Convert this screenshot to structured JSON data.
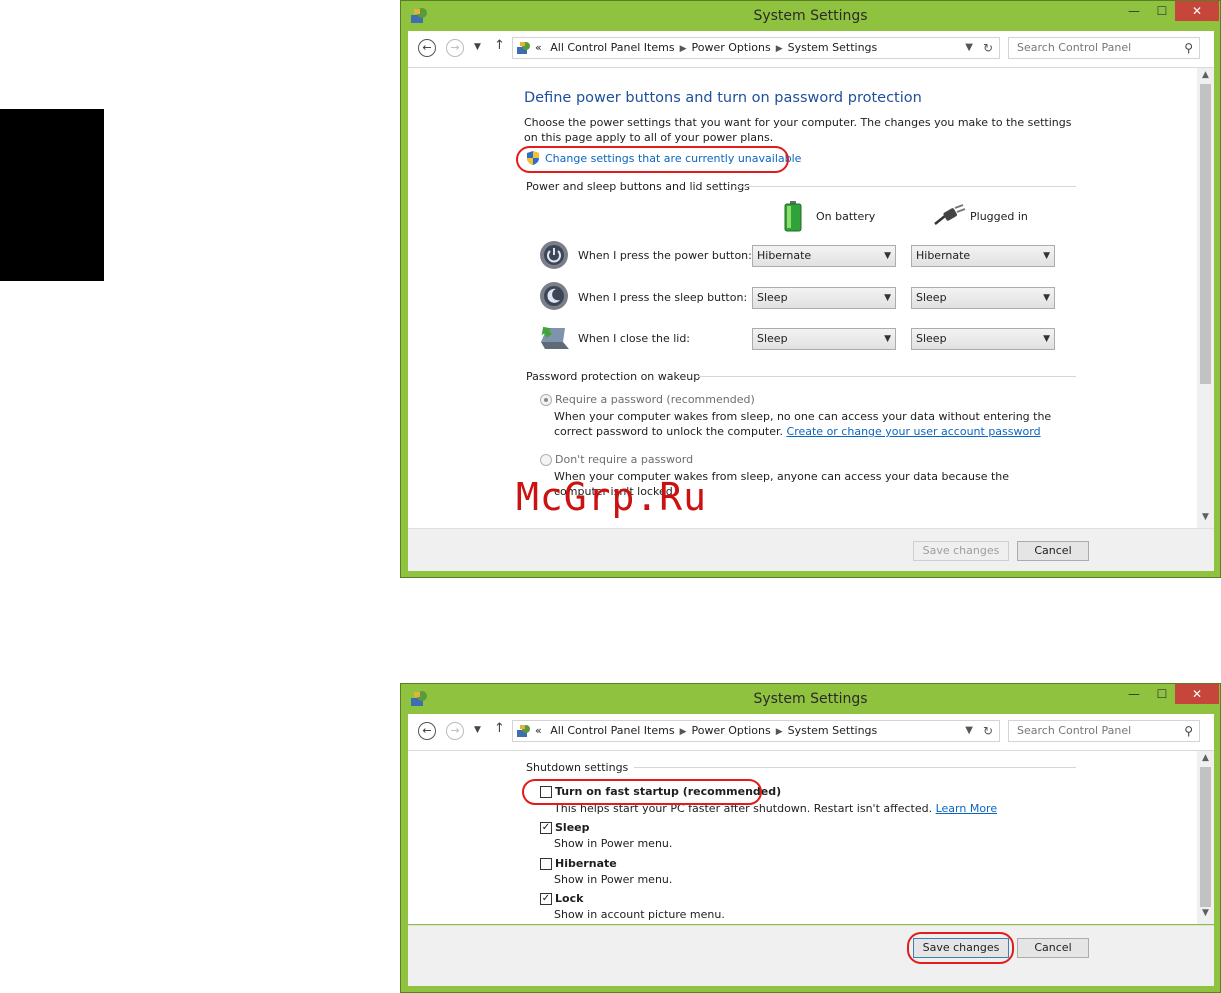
{
  "window1": {
    "title": "System Settings",
    "breadcrumb": {
      "prefix": "«",
      "items": [
        "All Control Panel Items",
        "Power Options",
        "System Settings"
      ]
    },
    "search_placeholder": "Search Control Panel",
    "heading": "Define power buttons and turn on password protection",
    "description": "Choose the power settings that you want for your computer. The changes you make to the settings on this page apply to all of your power plans.",
    "change_settings_link": "Change settings that are currently unavailable",
    "power_sleep_section": "Power and sleep buttons and lid settings",
    "column_battery": "On battery",
    "column_plugged": "Plugged in",
    "rows": [
      {
        "label": "When I press the power button:",
        "battery": "Hibernate",
        "plugged": "Hibernate"
      },
      {
        "label": "When I press the sleep button:",
        "battery": "Sleep",
        "plugged": "Sleep"
      },
      {
        "label": "When I close the lid:",
        "battery": "Sleep",
        "plugged": "Sleep"
      }
    ],
    "password_section": "Password protection on wakeup",
    "require_password": {
      "label": "Require a password (recommended)",
      "desc": "When your computer wakes from sleep, no one can access your data without entering the correct password to unlock the computer.",
      "link": "Create or change your user account password"
    },
    "no_password": {
      "label": "Don't require a password",
      "desc": "When your computer wakes from sleep, anyone can access your data because the computer isn't locked."
    },
    "save_button": "Save changes",
    "cancel_button": "Cancel"
  },
  "window2": {
    "title": "System Settings",
    "breadcrumb": {
      "prefix": "«",
      "items": [
        "All Control Panel Items",
        "Power Options",
        "System Settings"
      ]
    },
    "search_placeholder": "Search Control Panel",
    "shutdown_section": "Shutdown settings",
    "options": [
      {
        "label": "Turn on fast startup (recommended)",
        "desc": "This helps start your PC faster after shutdown. Restart isn't affected.",
        "link": "Learn More",
        "checked": false
      },
      {
        "label": "Sleep",
        "desc": "Show in Power menu.",
        "checked": true
      },
      {
        "label": "Hibernate",
        "desc": "Show in Power menu.",
        "checked": false
      },
      {
        "label": "Lock",
        "desc": "Show in account picture menu.",
        "checked": true
      }
    ],
    "save_button": "Save changes",
    "cancel_button": "Cancel"
  },
  "watermark": "McGrp.Ru",
  "colors": {
    "window_frame": "#8fc23f",
    "close_button": "#c7463c",
    "heading": "#1e4f9c",
    "link": "#0b66c2",
    "highlight": "#e21b1b"
  }
}
